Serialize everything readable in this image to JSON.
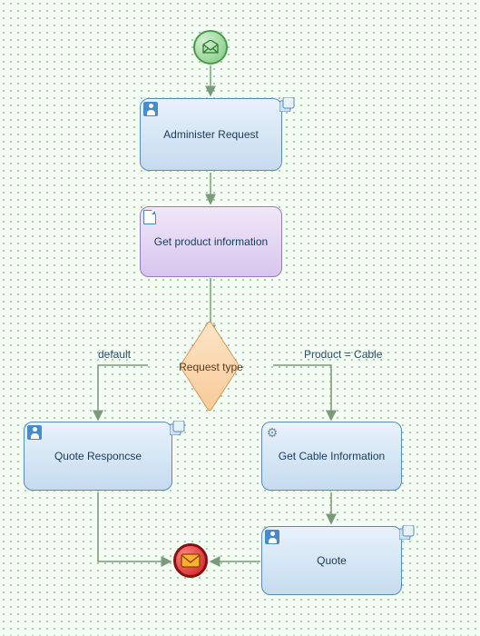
{
  "startIcon": "envelope-open",
  "endIcon": "envelope-closed",
  "nodes": {
    "administer": {
      "label": "Administer Request",
      "icon": "user"
    },
    "getProduct": {
      "label": "Get product information",
      "icon": "document"
    },
    "requestType": {
      "label": "Request type"
    },
    "quoteResponse": {
      "label": "Quote Responcse",
      "icon": "user"
    },
    "getCable": {
      "label": "Get Cable Information",
      "icon": "gear"
    },
    "quote": {
      "label": "Quote",
      "icon": "user"
    }
  },
  "edges": {
    "defaultLabel": "default",
    "cableLabel": "Product = Cable"
  }
}
